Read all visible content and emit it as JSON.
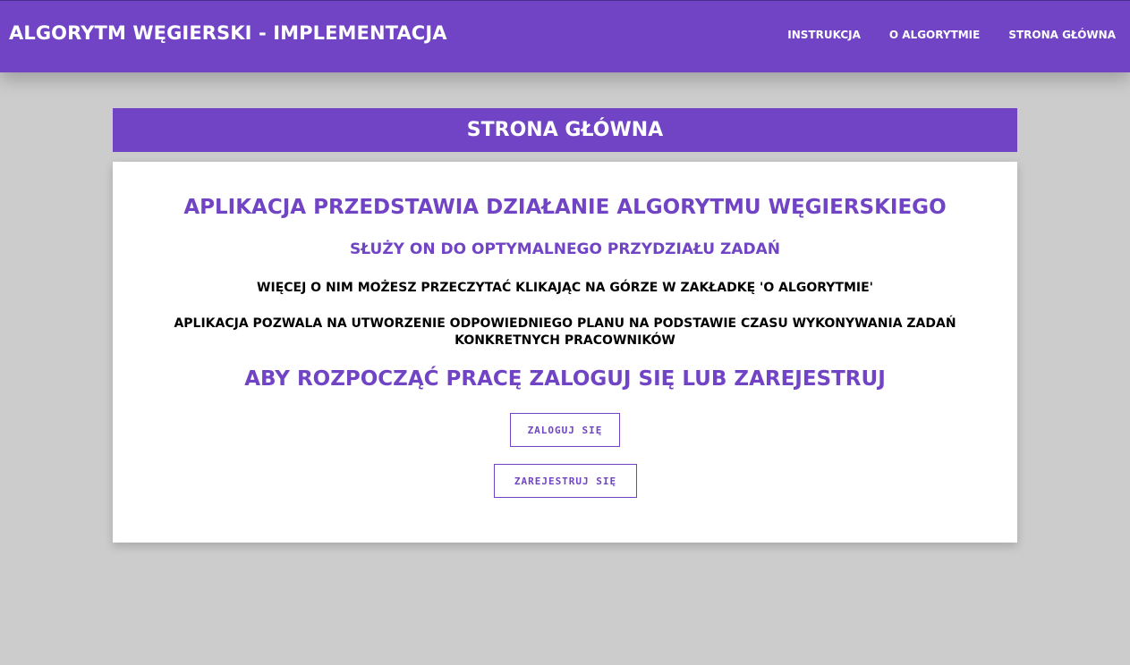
{
  "header": {
    "title": "ALGORYTM WĘGIERSKI - IMPLEMENTACJA",
    "nav": [
      {
        "label": "INSTRUKCJA"
      },
      {
        "label": "O ALGORYTMIE"
      },
      {
        "label": "STRONA GŁÓWNA"
      }
    ]
  },
  "main": {
    "section_title": "STRONA GŁÓWNA",
    "heading": "APLIKACJA PRZEDSTAWIA DZIAŁANIE ALGORYTMU WĘGIERSKIEGO",
    "subheading": "SŁUŻY ON DO OPTYMALNEGO PRZYDZIAŁU ZADAŃ",
    "paragraph1": "WIĘCEJ O NIM MOŻESZ PRZECZYTAĆ KLIKAJĄC NA GÓRZE W ZAKŁADKĘ 'O ALGORYTMIE'",
    "paragraph2": "APLIKACJA POZWALA NA UTWORZENIE ODPOWIEDNIEGO PLANU NA PODSTAWIE CZASU WYKONYWANIA ZADAŃ KONKRETNYCH PRACOWNIKÓW",
    "cta": "ABY ROZPOCZĄĆ PRACĘ ZALOGUJ SIĘ LUB ZAREJESTRUJ",
    "login_label": "ZALOGUJ SIĘ",
    "register_label": "ZAREJESTRUJ SIĘ"
  },
  "colors": {
    "accent": "#7044c4",
    "background": "#cccccc"
  }
}
